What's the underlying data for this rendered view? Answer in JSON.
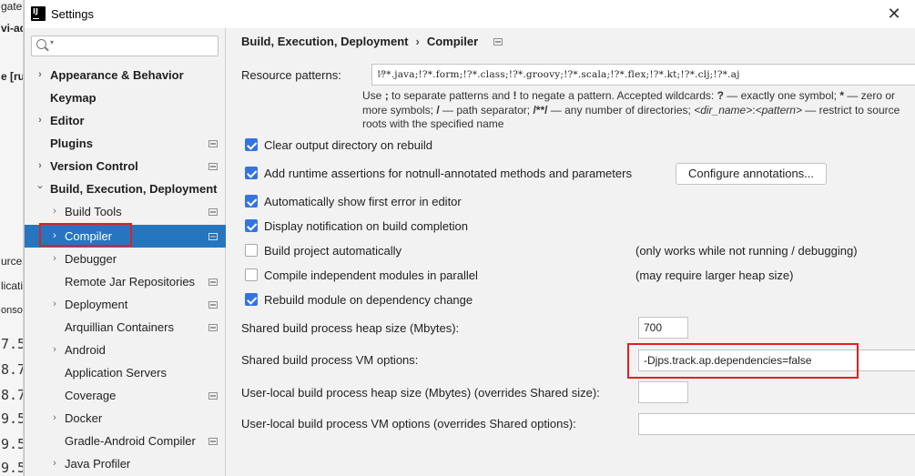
{
  "background_ide": {
    "fragments": [
      "gate",
      "vi-ad",
      "e [ru",
      "urces",
      "licati",
      "onso"
    ],
    "numbers": [
      "7.5",
      "8.7",
      "8.7",
      "9.5",
      "9.5",
      "9.5"
    ]
  },
  "window": {
    "title": "Settings",
    "close_glyph": "✕"
  },
  "search": {
    "value": "",
    "caret": "▾"
  },
  "tree": {
    "items": [
      {
        "label": "Appearance & Behavior",
        "arrow": "›"
      },
      {
        "label": "Keymap",
        "arrow": ""
      },
      {
        "label": "Editor",
        "arrow": "›"
      },
      {
        "label": "Plugins",
        "arrow": ""
      },
      {
        "label": "Version Control",
        "arrow": "›"
      },
      {
        "label": "Build, Execution, Deployment",
        "arrow": "⌄"
      },
      {
        "label": "Build Tools",
        "arrow": "›"
      },
      {
        "label": "Compiler",
        "arrow": "›"
      },
      {
        "label": "Debugger",
        "arrow": "›"
      },
      {
        "label": "Remote Jar Repositories",
        "arrow": ""
      },
      {
        "label": "Deployment",
        "arrow": "›"
      },
      {
        "label": "Arquillian Containers",
        "arrow": ""
      },
      {
        "label": "Android",
        "arrow": "›"
      },
      {
        "label": "Application Servers",
        "arrow": ""
      },
      {
        "label": "Coverage",
        "arrow": ""
      },
      {
        "label": "Docker",
        "arrow": "›"
      },
      {
        "label": "Gradle-Android Compiler",
        "arrow": ""
      },
      {
        "label": "Java Profiler",
        "arrow": "›"
      }
    ],
    "selected": "Compiler"
  },
  "breadcrumb": {
    "parent": "Build, Execution, Deployment",
    "separator": "›",
    "current": "Compiler"
  },
  "resource_patterns": {
    "label": "Resource patterns:",
    "value": "!?*.java;!?*.form;!?*.class;!?*.groovy;!?*.scala;!?*.flex;!?*.kt;!?*.clj;!?*.aj",
    "expand_glyph": "⤢"
  },
  "hint": {
    "use": "Use ",
    "semicolon": ";",
    "to_sep": " to separate patterns and ",
    "bang": "!",
    "to_neg": " to negate a pattern. Accepted wildcards: ",
    "q": "?",
    "q_desc": " — exactly one symbol; ",
    "star": "*",
    "star_desc": " — zero or more symbols; ",
    "slash": "/",
    "slash_desc": " — path separator; ",
    "dstar": "/**/",
    "dstar_desc": " — any number of directories; ",
    "dir_name": "<dir_name>",
    "colon": ":",
    "pattern": "<pattern>",
    "rest": " — restrict to source roots with the specified name"
  },
  "options": [
    {
      "label": "Clear output directory on rebuild",
      "checked": true
    },
    {
      "label": "Add runtime assertions for notnull-annotated methods and parameters",
      "checked": true
    },
    {
      "label": "Automatically show first error in editor",
      "checked": true
    },
    {
      "label": "Display notification on build completion",
      "checked": true
    },
    {
      "label": "Build project automatically",
      "checked": false,
      "note": "(only works while not running / debugging)"
    },
    {
      "label": "Compile independent modules in parallel",
      "checked": false,
      "note": "(may require larger heap size)"
    },
    {
      "label": "Rebuild module on dependency change",
      "checked": true
    }
  ],
  "configure_button": "Configure annotations...",
  "fields": {
    "heap_label": "Shared build process heap size (Mbytes):",
    "heap_value": "700",
    "vm_label": "Shared build process VM options:",
    "vm_value": "-Djps.track.ap.dependencies=false",
    "user_heap_label": "User-local build process heap size (Mbytes) (overrides Shared size):",
    "user_heap_value": "",
    "user_vm_label": "User-local build process VM options (overrides Shared options):",
    "user_vm_value": ""
  },
  "colors": {
    "selection": "#2675bf",
    "checkbox": "#3574e0",
    "highlight_box": "#e02020"
  }
}
